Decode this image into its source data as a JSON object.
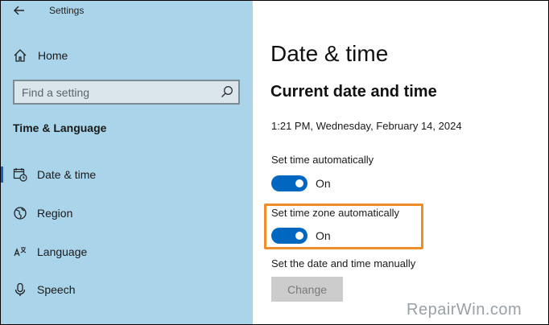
{
  "window": {
    "title": "Settings"
  },
  "sidebar": {
    "home_label": "Home",
    "search_placeholder": "Find a setting",
    "section_title": "Time & Language",
    "items": [
      {
        "label": "Date & time",
        "icon": "calendar-clock-icon",
        "selected": true
      },
      {
        "label": "Region",
        "icon": "globe-icon",
        "selected": false
      },
      {
        "label": "Language",
        "icon": "language-icon",
        "selected": false
      },
      {
        "label": "Speech",
        "icon": "microphone-icon",
        "selected": false
      }
    ]
  },
  "main": {
    "page_title": "Date & time",
    "section_title": "Current date and time",
    "current_datetime": "1:21 PM, Wednesday, February 14, 2024",
    "set_time_auto": {
      "label": "Set time automatically",
      "state": "On"
    },
    "set_timezone_auto": {
      "label": "Set time zone automatically",
      "state": "On"
    },
    "manual": {
      "label": "Set the date and time manually",
      "button": "Change"
    }
  },
  "watermark": "RepairWin.com",
  "colors": {
    "sidebar_bg": "#a9d4ea",
    "toggle_on": "#0067c0",
    "highlight": "#f08d2b",
    "selected_indicator": "#1a5fb4"
  }
}
